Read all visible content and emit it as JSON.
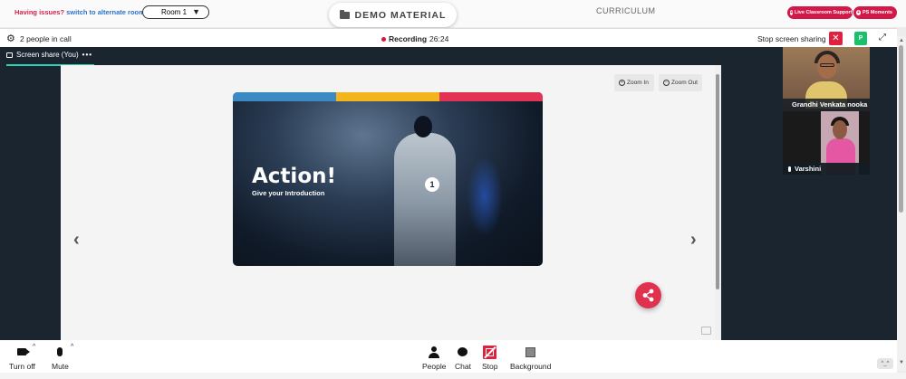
{
  "topbar": {
    "issues_label": "Having issues?",
    "alternate_link": "switch to alternate room",
    "room_value": "Room 1",
    "demo_material_label": "DEMO MATERIAL",
    "curriculum_label": "CURRICULUM",
    "live_support_label": "Live Classroom Support",
    "ps_moments_label": "PS Moments"
  },
  "callbar": {
    "people_count": "2 people in call",
    "recording_label": "Recording",
    "recording_time": "26:24",
    "stop_sharing_label": "Stop screen sharing",
    "close_symbol": "✕",
    "p_label": "P"
  },
  "stage": {
    "share_tab_label": "Screen share (You)",
    "share_tab_more": "•••",
    "zoom_in_label": "Zoom In",
    "zoom_out_label": "Zoom Out",
    "prev_arrow": "‹",
    "next_arrow": "›"
  },
  "slide": {
    "title": "Action!",
    "subtitle": "Give your Introduction",
    "badge_number": "1",
    "stripe_colors": [
      "#3b8ac4",
      "#f2b51d",
      "#e33354"
    ]
  },
  "participants": [
    {
      "name": "Grandhi Venkata nooka ra..."
    },
    {
      "name": "Varshini"
    }
  ],
  "controls": {
    "camera_label": "Turn off",
    "mic_label": "Mute",
    "people_label": "People",
    "chat_label": "Chat",
    "stop_label": "Stop",
    "background_label": "Background"
  },
  "colors": {
    "accent_red": "#d3184a",
    "stage_bg": "#1b2530",
    "active_tab_underline": "#2bd4b4",
    "p_button": "#1bc06a"
  },
  "icons": [
    "folder-icon",
    "gear-icon",
    "recording-dot-icon",
    "close-icon",
    "expand-icon",
    "screen-icon",
    "zoom-in-icon",
    "zoom-out-icon",
    "chevron-left-icon",
    "chevron-right-icon",
    "share-icon",
    "mic-icon",
    "camera-icon",
    "people-icon",
    "chat-icon",
    "stop-share-icon",
    "background-icon"
  ]
}
